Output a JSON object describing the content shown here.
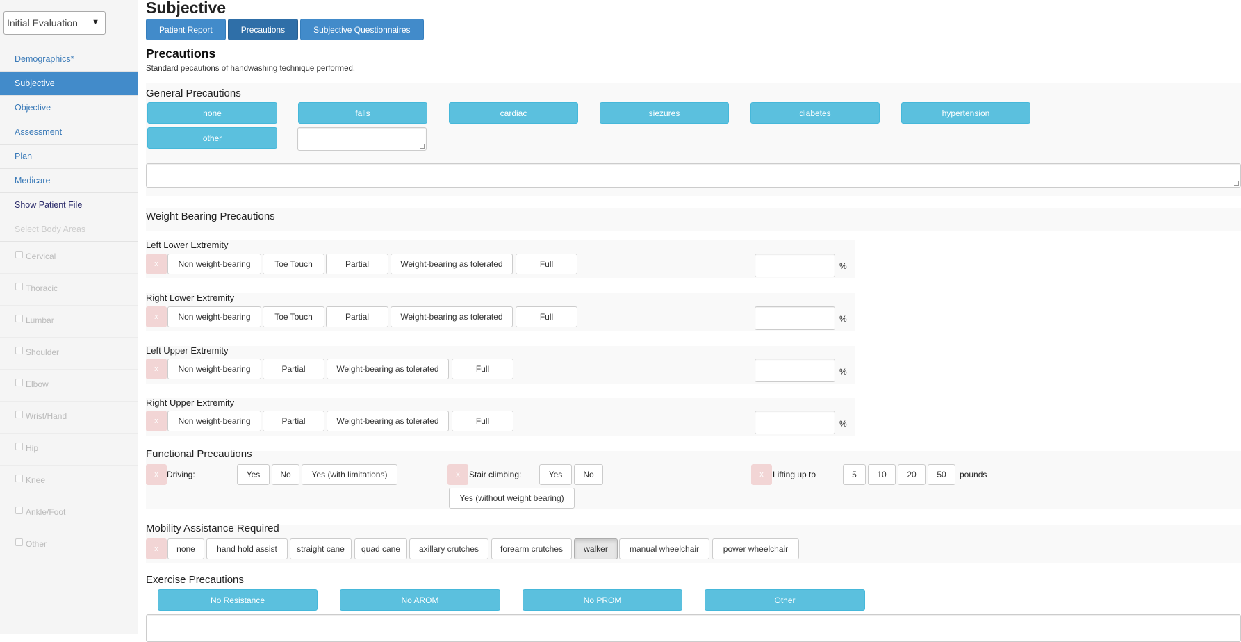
{
  "sidebar": {
    "select_value": "Initial Evaluation",
    "nav": [
      {
        "label": "Demographics*"
      },
      {
        "label": "Subjective"
      },
      {
        "label": "Objective"
      },
      {
        "label": "Assessment"
      },
      {
        "label": "Plan"
      },
      {
        "label": "Medicare"
      },
      {
        "label": "Show Patient File"
      },
      {
        "label": "Select Body Areas"
      }
    ],
    "body_areas": [
      "Cervical",
      "Thoracic",
      "Lumbar",
      "Shoulder",
      "Elbow",
      "Wrist/Hand",
      "Hip",
      "Knee",
      "Ankle/Foot",
      "Other"
    ]
  },
  "header": {
    "title": "Subjective",
    "tabs": [
      "Patient Report",
      "Precautions",
      "Subjective Questionnaires"
    ]
  },
  "section": {
    "title": "Precautions",
    "description": "Standard pecautions of handwashing technique performed."
  },
  "general": {
    "heading": "General Precautions",
    "buttons": [
      "none",
      "falls",
      "cardiac",
      "siezures",
      "diabetes",
      "hypertension",
      "other"
    ]
  },
  "weight_bearing": {
    "heading": "Weight Bearing Precautions",
    "clear": "x",
    "percent": "%",
    "rows": [
      {
        "label": "Left Lower Extremity",
        "options": [
          "Non weight-bearing",
          "Toe Touch",
          "Partial",
          "Weight-bearing as tolerated",
          "Full"
        ]
      },
      {
        "label": "Right Lower Extremity",
        "options": [
          "Non weight-bearing",
          "Toe Touch",
          "Partial",
          "Weight-bearing as tolerated",
          "Full"
        ]
      },
      {
        "label": "Left Upper Extremity",
        "options": [
          "Non weight-bearing",
          "Partial",
          "Weight-bearing as tolerated",
          "Full"
        ]
      },
      {
        "label": "Right Upper Extremity",
        "options": [
          "Non weight-bearing",
          "Partial",
          "Weight-bearing as tolerated",
          "Full"
        ]
      }
    ]
  },
  "functional": {
    "heading": "Functional Precautions",
    "driving": {
      "label": "Driving:",
      "options": [
        "Yes",
        "No",
        "Yes (with limitations)"
      ]
    },
    "stairs": {
      "label": "Stair climbing:",
      "options": [
        "Yes",
        "No",
        "Yes (without weight bearing)"
      ]
    },
    "lifting": {
      "label": "Lifting up to",
      "options": [
        "5",
        "10",
        "20",
        "50"
      ],
      "unit": "pounds"
    }
  },
  "mobility": {
    "heading": "Mobility Assistance Required",
    "options": [
      "none",
      "hand hold assist",
      "straight cane",
      "quad cane",
      "axillary crutches",
      "forearm crutches",
      "walker",
      "manual wheelchair",
      "power wheelchair"
    ],
    "selected": "walker"
  },
  "exercise": {
    "heading": "Exercise Precautions",
    "buttons": [
      "No Resistance",
      "No AROM",
      "No PROM",
      "Other"
    ]
  }
}
